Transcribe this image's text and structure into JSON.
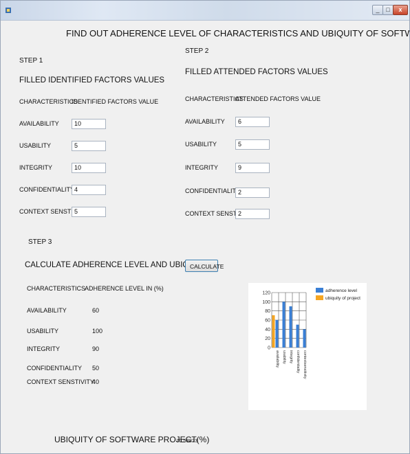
{
  "window": {
    "minimize_glyph": "_",
    "maximize_glyph": "□",
    "close_glyph": "x"
  },
  "title": "FIND OUT ADHERENCE LEVEL OF CHARACTERISTICS AND UBIQUITY OF SOFTWARE PROJECT",
  "step1": {
    "label": "STEP 1",
    "heading": "FILLED IDENTIFIED FACTORS VALUES",
    "col1": "CHARACTERISTICS",
    "col2": "IDENTIFIED FACTORS VALUE",
    "rows": [
      {
        "label": "AVAILABILITY",
        "value": "10"
      },
      {
        "label": "USABILITY",
        "value": "5"
      },
      {
        "label": "INTEGRITY",
        "value": "10"
      },
      {
        "label": "CONFIDENTIALITY",
        "value": "4"
      },
      {
        "label": "CONTEXT SENSTIVITY",
        "value": "5"
      }
    ]
  },
  "step2": {
    "label": "STEP 2",
    "heading": "FILLED ATTENDED FACTORS VALUES",
    "col1": "CHARACTERISTICS",
    "col2": "ATTENDED FACTORS VALUE",
    "rows": [
      {
        "label": "AVAILABILITY",
        "value": "6"
      },
      {
        "label": "USABILITY",
        "value": "5"
      },
      {
        "label": "INTEGRITY",
        "value": "9"
      },
      {
        "label": "CONFIDENTIALITY",
        "value": "2"
      },
      {
        "label": "CONTEXT SENSTIVITY",
        "value": "2"
      }
    ]
  },
  "step3": {
    "label": "STEP 3",
    "heading": "CALCULATE ADHERENCE LEVEL AND UBIQUITY",
    "button": "CALCULATE",
    "col1": "CHARACTERISTICS",
    "col2": "ADHERENCE LEVEL IN (%)",
    "rows": [
      {
        "label": "AVAILABILITY",
        "value": "60"
      },
      {
        "label": "USABILITY",
        "value": "100"
      },
      {
        "label": "INTEGRITY",
        "value": "90"
      },
      {
        "label": "CONFIDENTIALITY",
        "value": "50"
      },
      {
        "label": "CONTEXT SENSTIVITY",
        "value": "40"
      }
    ]
  },
  "ubiquity": {
    "label": "UBIQUITY OF SOFTWARE PROJECT(%)",
    "value": "70.58823"
  },
  "chart_data": {
    "type": "bar",
    "categories": [
      "availability",
      "usability",
      "integrity",
      "confidentiality",
      "contextsensitivity"
    ],
    "series": [
      {
        "name": "adherence level",
        "color": "#3a7fd5",
        "values": [
          60,
          100,
          90,
          50,
          40
        ]
      },
      {
        "name": "ubiquity of project",
        "color": "#f5a623",
        "values": [
          70.58823,
          null,
          null,
          null,
          null
        ]
      }
    ],
    "ylim": [
      0,
      120
    ],
    "yticks": [
      0,
      20,
      40,
      60,
      80,
      100,
      120
    ],
    "grid": true,
    "legend": "top-right"
  }
}
